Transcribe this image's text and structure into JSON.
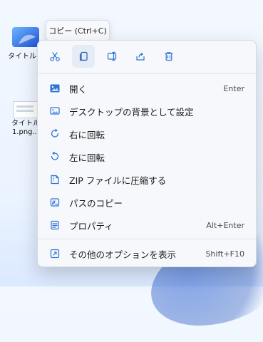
{
  "desktop": {
    "items": [
      {
        "label": "タイトルな"
      },
      {
        "label": "タイトル\n1.png..."
      }
    ]
  },
  "tooltip": {
    "text": "コピー (Ctrl+C)"
  },
  "toolbar": {
    "buttons": [
      {
        "name": "cut",
        "icon": "scissors-icon"
      },
      {
        "name": "copy",
        "icon": "copy-icon",
        "selected": true
      },
      {
        "name": "rename",
        "icon": "rename-icon"
      },
      {
        "name": "share",
        "icon": "share-icon"
      },
      {
        "name": "delete",
        "icon": "trash-icon"
      }
    ]
  },
  "menu": {
    "items": [
      {
        "label": "開く",
        "shortcut": "Enter",
        "icon": "image-open-icon"
      },
      {
        "label": "デスクトップの背景として設定",
        "shortcut": "",
        "icon": "wallpaper-icon"
      },
      {
        "label": "右に回転",
        "shortcut": "",
        "icon": "rotate-right-icon"
      },
      {
        "label": "左に回転",
        "shortcut": "",
        "icon": "rotate-left-icon"
      },
      {
        "label": "ZIP ファイルに圧縮する",
        "shortcut": "",
        "icon": "zip-icon"
      },
      {
        "label": "パスのコピー",
        "shortcut": "",
        "icon": "copy-path-icon"
      },
      {
        "label": "プロパティ",
        "shortcut": "Alt+Enter",
        "icon": "properties-icon"
      },
      {
        "label": "その他のオプションを表示",
        "shortcut": "Shift+F10",
        "icon": "more-options-icon"
      }
    ]
  },
  "colors": {
    "accent": "#2b73d6"
  }
}
